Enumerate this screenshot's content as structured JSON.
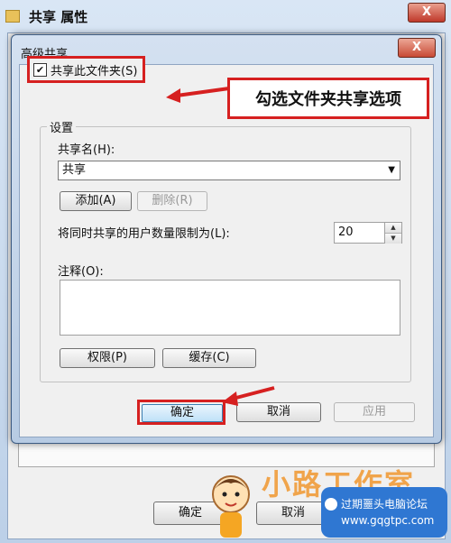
{
  "bg_window": {
    "title": "共享 属性",
    "close": "X",
    "ok": "确定",
    "cancel": "取消"
  },
  "dialog": {
    "title": "高级共享",
    "close": "X",
    "share_checkbox_label": "共享此文件夹(S)",
    "share_checkbox_checked": true,
    "settings_group": "设置",
    "share_name_label": "共享名(H):",
    "share_name_value": "共享",
    "add_button": "添加(A)",
    "remove_button": "删除(R)",
    "limit_label": "将同时共享的用户数量限制为(L):",
    "limit_value": "20",
    "comment_label": "注释(O):",
    "comment_value": "",
    "permissions_button": "权限(P)",
    "cache_button": "缓存(C)",
    "ok_button": "确定",
    "cancel_button": "取消",
    "apply_button": "应用"
  },
  "annotation": {
    "callout_text": "勾选文件夹共享选项",
    "highlight_color": "#d62020"
  },
  "watermark": {
    "brand": "小路工作室",
    "forum_line1": "过期噩头电脑论坛",
    "forum_line2": "www.gqgtpc.com"
  }
}
